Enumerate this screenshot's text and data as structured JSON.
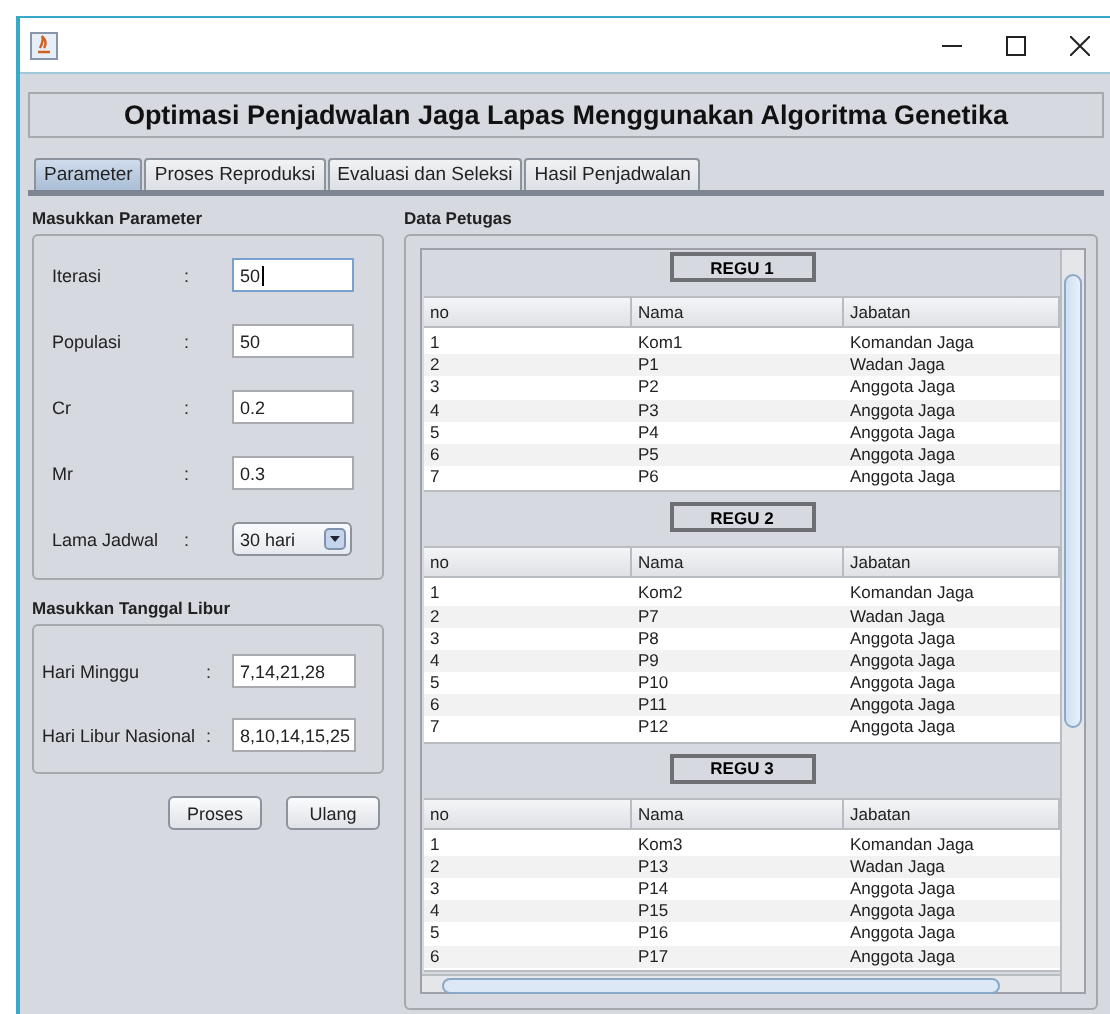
{
  "header": "Optimasi Penjadwalan Jaga Lapas Menggunakan Algoritma Genetika",
  "tabs": [
    {
      "label": "Parameter",
      "selected": true
    },
    {
      "label": "Proses Reproduksi",
      "selected": false
    },
    {
      "label": "Evaluasi dan Seleksi",
      "selected": false
    },
    {
      "label": "Hasil Penjadwalan",
      "selected": false
    }
  ],
  "parameter_panel": {
    "title": "Masukkan Parameter",
    "fields": [
      {
        "label": "Iterasi",
        "colon": ":",
        "value": "50",
        "kind": "text",
        "focused": true
      },
      {
        "label": "Populasi",
        "colon": ":",
        "value": "50",
        "kind": "text",
        "focused": false
      },
      {
        "label": "Cr",
        "colon": ":",
        "value": "0.2",
        "kind": "text",
        "focused": false
      },
      {
        "label": "Mr",
        "colon": ":",
        "value": "0.3",
        "kind": "text",
        "focused": false
      },
      {
        "label": "Lama Jadwal",
        "colon": ":",
        "value": "30 hari",
        "kind": "combo",
        "focused": false
      }
    ]
  },
  "holiday_panel": {
    "title": "Masukkan Tanggal Libur",
    "fields": [
      {
        "label": "Hari Minggu",
        "colon": ":",
        "value": "7,14,21,28",
        "kind": "text",
        "focused": false
      },
      {
        "label": "Hari Libur Nasional",
        "colon": ":",
        "value": "8,10,14,15,25",
        "kind": "text",
        "focused": false
      }
    ]
  },
  "buttons": [
    "Proses",
    "Ulang"
  ],
  "data_panel": {
    "title": "Data Petugas",
    "groups": [
      {
        "title": "REGU 1",
        "columns": [
          "no",
          "Nama",
          "Jabatan"
        ],
        "rows": [
          [
            "1",
            "Kom1",
            "Komandan Jaga"
          ],
          [
            "2",
            "P1",
            "Wadan Jaga"
          ],
          [
            "3",
            "P2",
            "Anggota Jaga"
          ],
          [
            "4",
            "P3",
            "Anggota Jaga"
          ],
          [
            "5",
            "P4",
            "Anggota Jaga"
          ],
          [
            "6",
            "P5",
            "Anggota Jaga"
          ],
          [
            "7",
            "P6",
            "Anggota Jaga"
          ]
        ]
      },
      {
        "title": "REGU 2",
        "columns": [
          "no",
          "Nama",
          "Jabatan"
        ],
        "rows": [
          [
            "1",
            "Kom2",
            "Komandan Jaga"
          ],
          [
            "2",
            "P7",
            "Wadan Jaga"
          ],
          [
            "3",
            "P8",
            "Anggota Jaga"
          ],
          [
            "4",
            "P9",
            "Anggota Jaga"
          ],
          [
            "5",
            "P10",
            "Anggota Jaga"
          ],
          [
            "6",
            "P11",
            "Anggota Jaga"
          ],
          [
            "7",
            "P12",
            "Anggota Jaga"
          ]
        ]
      },
      {
        "title": "REGU 3",
        "columns": [
          "no",
          "Nama",
          "Jabatan"
        ],
        "rows": [
          [
            "1",
            "Kom3",
            "Komandan Jaga"
          ],
          [
            "2",
            "P13",
            "Wadan Jaga"
          ],
          [
            "3",
            "P14",
            "Anggota Jaga"
          ],
          [
            "4",
            "P15",
            "Anggota Jaga"
          ],
          [
            "5",
            "P16",
            "Anggota Jaga"
          ],
          [
            "6",
            "P17",
            "Anggota Jaga"
          ]
        ]
      }
    ]
  }
}
